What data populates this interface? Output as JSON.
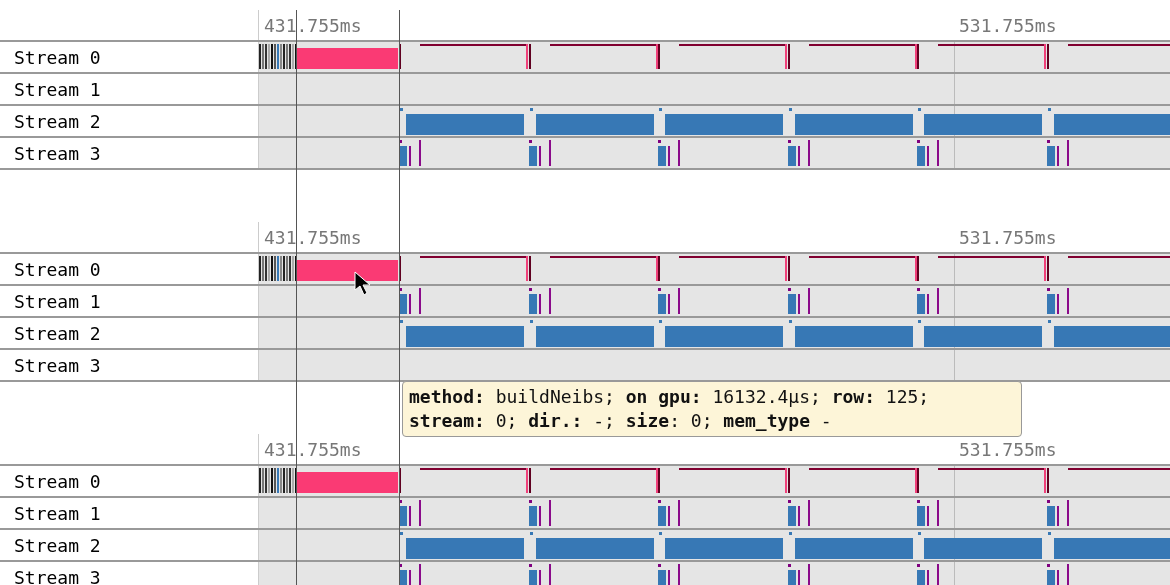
{
  "panels": [
    {
      "ticks": [
        "431.755ms",
        "531.755ms"
      ],
      "streams": [
        {
          "name": "Stream 0",
          "kind": "kernels"
        },
        {
          "name": "Stream 1",
          "kind": "idle"
        },
        {
          "name": "Stream 2",
          "kind": "transfers"
        },
        {
          "name": "Stream 3",
          "kind": "launches"
        }
      ]
    },
    {
      "ticks": [
        "431.755ms",
        "531.755ms"
      ],
      "streams": [
        {
          "name": "Stream 0",
          "kind": "kernels"
        },
        {
          "name": "Stream 1",
          "kind": "launches"
        },
        {
          "name": "Stream 2",
          "kind": "transfers"
        },
        {
          "name": "Stream 3",
          "kind": "idle"
        }
      ]
    },
    {
      "ticks": [
        "431.755ms",
        "531.755ms"
      ],
      "streams": [
        {
          "name": "Stream 0",
          "kind": "kernels"
        },
        {
          "name": "Stream 1",
          "kind": "launches"
        },
        {
          "name": "Stream 2",
          "kind": "transfers"
        },
        {
          "name": "Stream 3",
          "kind": "launches"
        }
      ]
    }
  ],
  "tooltip": {
    "lines": [
      "**method:** buildNeibs; **on gpu:** 16132.4µs; **row:** 125;",
      "**stream:** 0; **dir.:** -; **size**: 0; **mem_type** -"
    ]
  }
}
